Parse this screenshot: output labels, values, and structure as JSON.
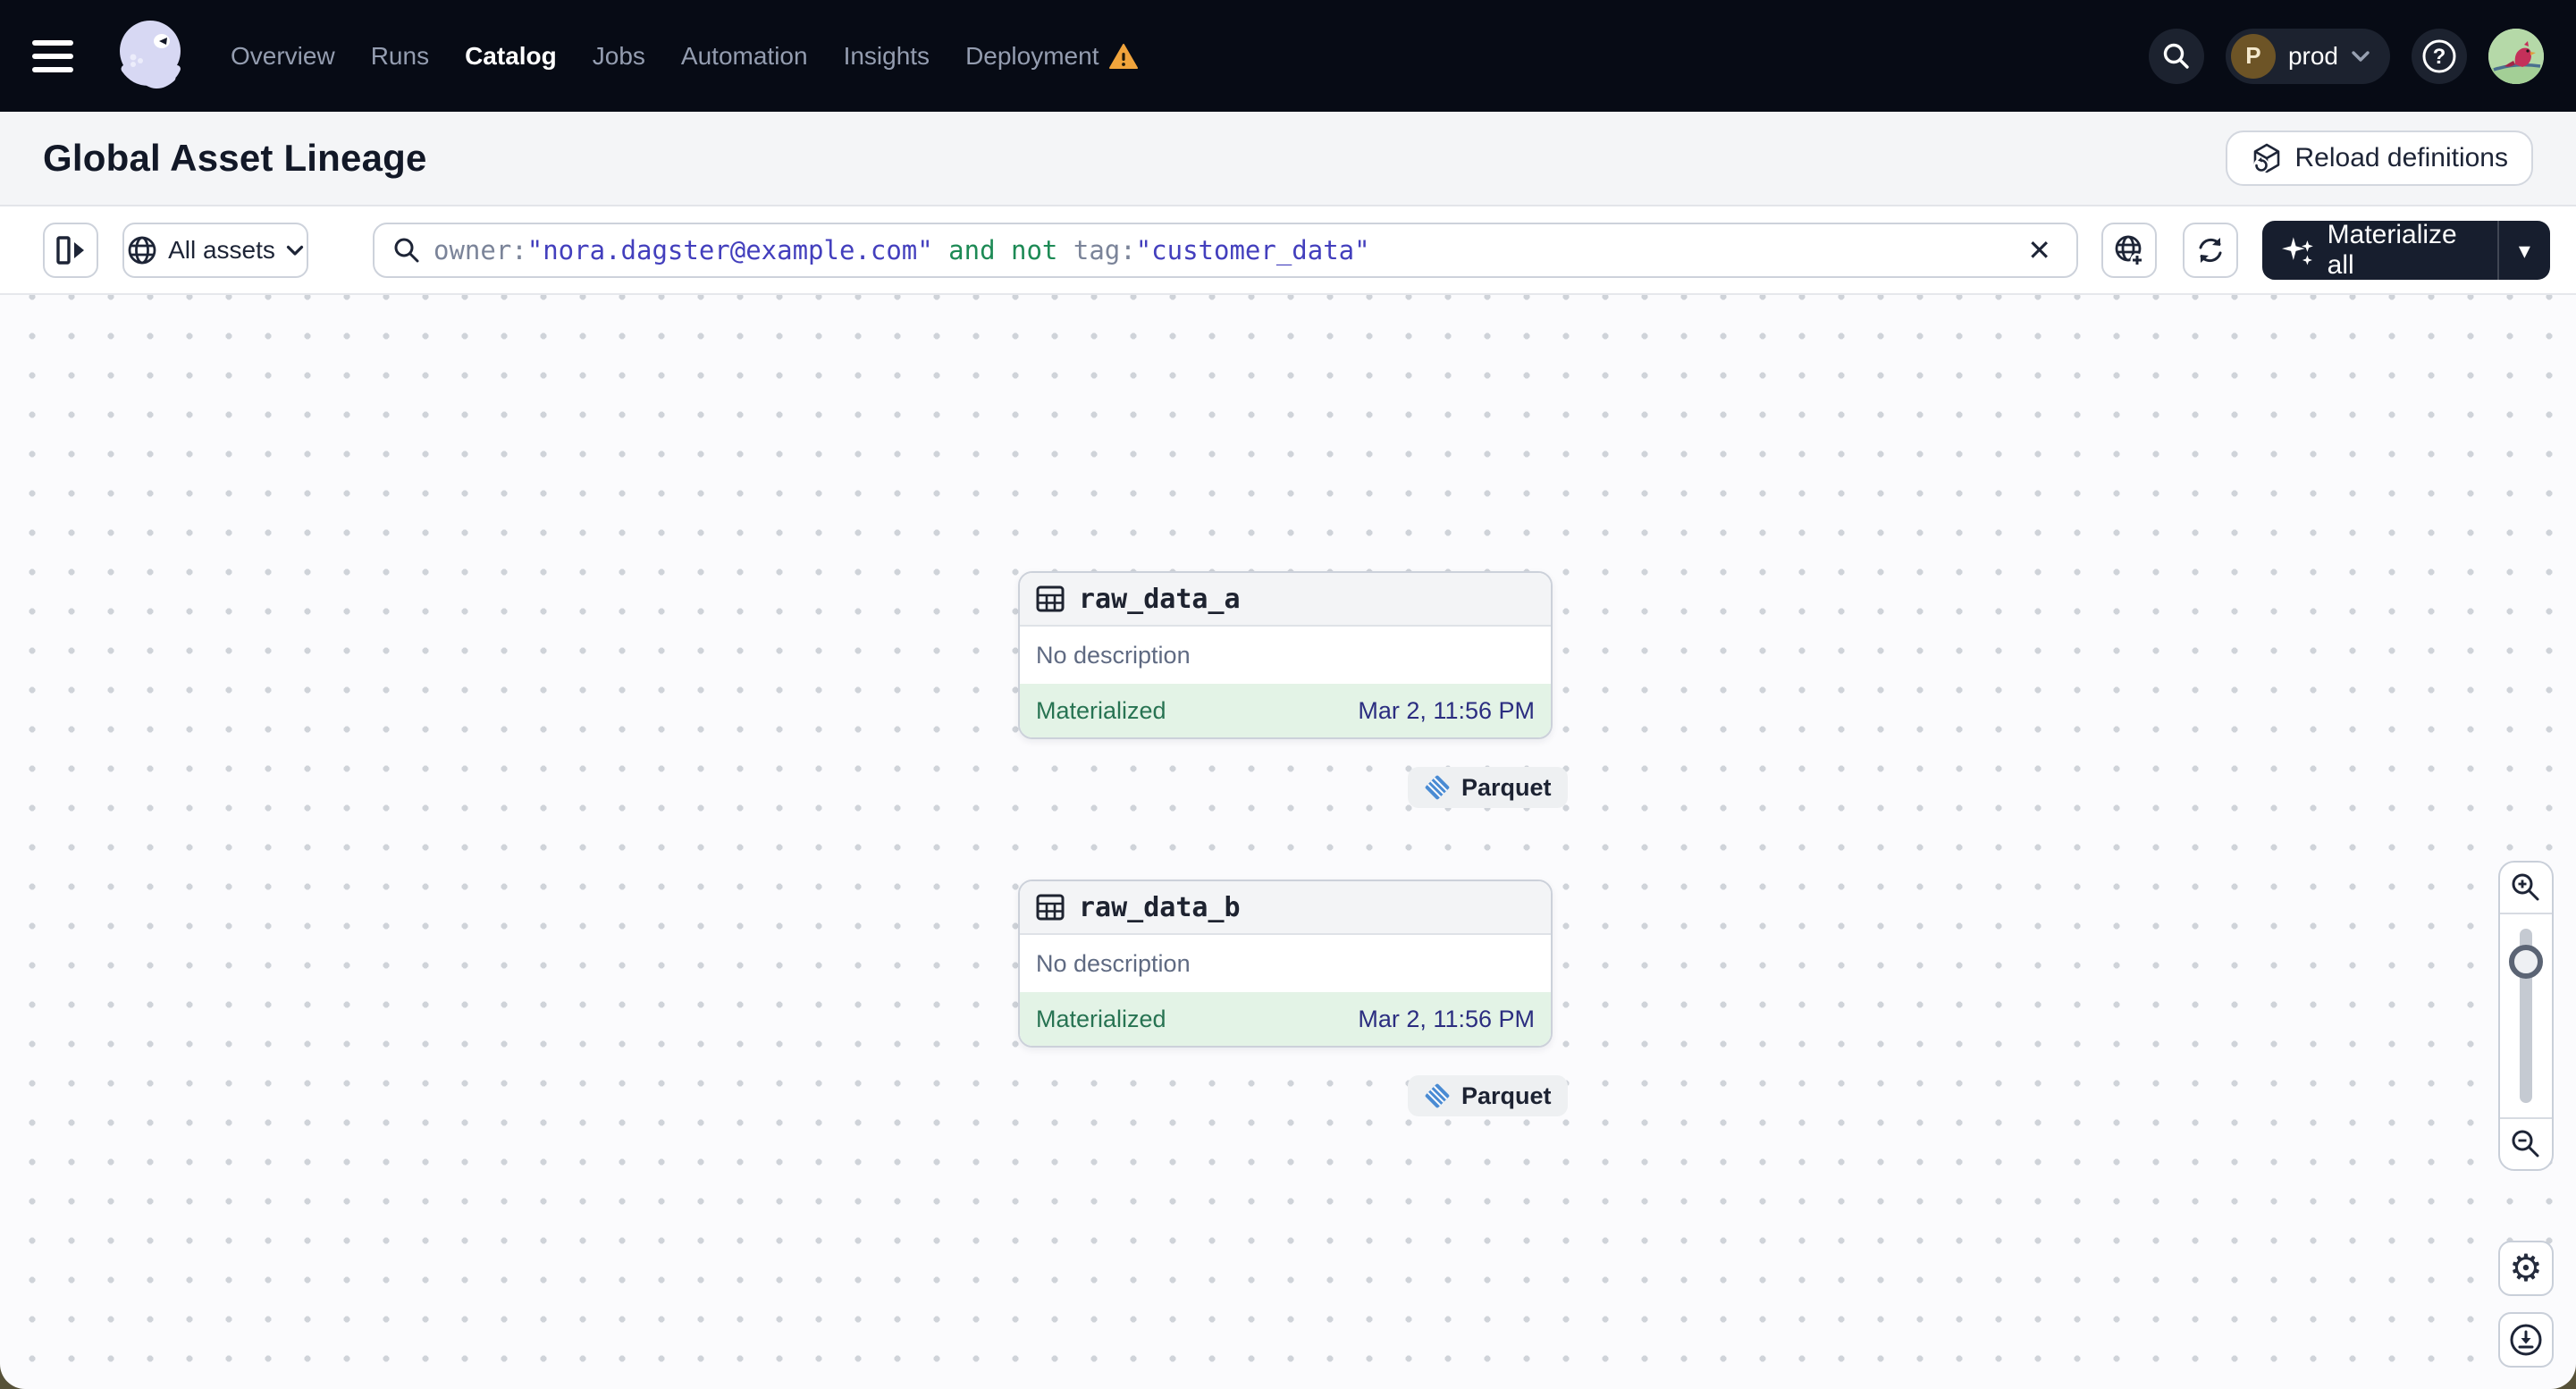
{
  "nav": {
    "items": [
      {
        "label": "Overview"
      },
      {
        "label": "Runs"
      },
      {
        "label": "Catalog"
      },
      {
        "label": "Jobs"
      },
      {
        "label": "Automation"
      },
      {
        "label": "Insights"
      },
      {
        "label": "Deployment"
      }
    ],
    "active_item": "Catalog",
    "deployment_switcher": {
      "initial": "P",
      "name": "prod"
    }
  },
  "header": {
    "title": "Global Asset Lineage",
    "reload_label": "Reload definitions"
  },
  "toolbar": {
    "scope_label": "All assets",
    "query": {
      "field1": "owner:",
      "value1": "\"nora.dagster@example.com\"",
      "keyword": " and not ",
      "field2": "tag:",
      "value2": "\"customer_data\""
    },
    "materialize_label": "Materialize all"
  },
  "assets": [
    {
      "name": "raw_data_a",
      "description": "No description",
      "status": "Materialized",
      "timestamp": "Mar 2, 11:56 PM",
      "tag": "Parquet"
    },
    {
      "name": "raw_data_b",
      "description": "No description",
      "status": "Materialized",
      "timestamp": "Mar 2, 11:56 PM",
      "tag": "Parquet"
    }
  ],
  "icons": {
    "gear": "⚙",
    "close": "✕",
    "caret": "▾",
    "question": "?"
  },
  "colors": {
    "nav_bg": "#070b15",
    "accent_dark": "#171e2e",
    "status_green": "#277352",
    "status_green_bg": "#e3f3e6",
    "query_value_indigo": "#433fbd",
    "query_keyword_green": "#1d8a55",
    "timestamp_indigo": "#2b2d80",
    "warning_orange": "#f0a43c",
    "parquet_blue": "#4a8bd3"
  }
}
